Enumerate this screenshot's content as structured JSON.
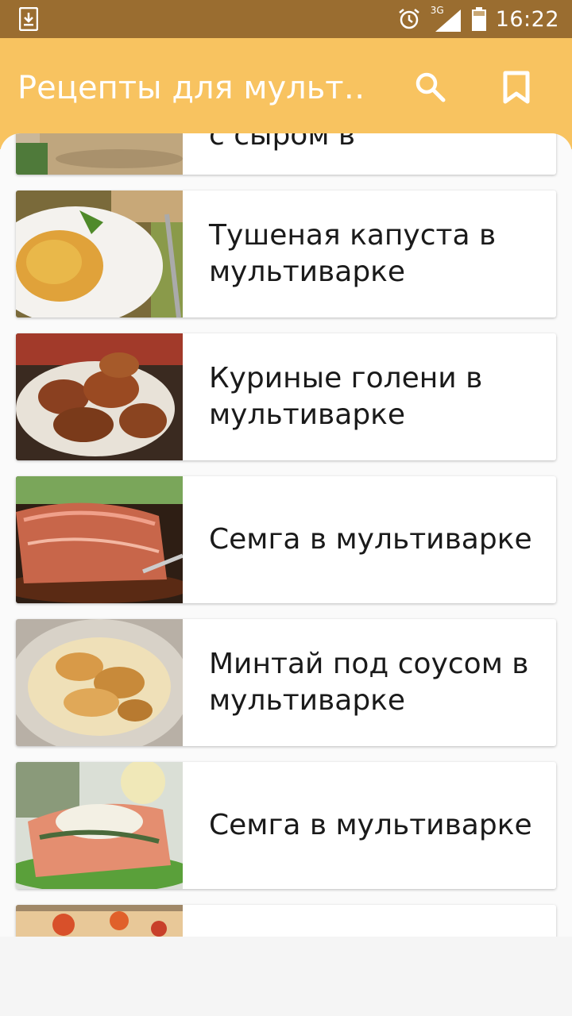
{
  "status_bar": {
    "time": "16:22",
    "network": "3G",
    "icons": [
      "download-icon",
      "alarm-icon",
      "signal-icon",
      "battery-icon"
    ]
  },
  "app_bar": {
    "title": "Рецепты для мульт…",
    "actions": [
      "search-icon",
      "bookmark-icon"
    ],
    "color": "#f8c360"
  },
  "recipes": [
    {
      "title": "с сыром в"
    },
    {
      "title": "Тушеная капуста в мультиварке"
    },
    {
      "title": "Куриные голени в мультиварке"
    },
    {
      "title": "Семга в мультиварке"
    },
    {
      "title": "Минтай под соусом в мультиварке"
    },
    {
      "title": "Семга в мультиварке"
    },
    {
      "title": ""
    }
  ]
}
